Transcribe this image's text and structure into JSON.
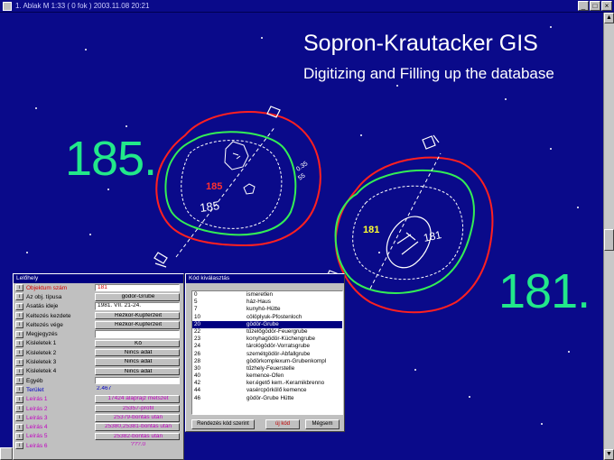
{
  "window": {
    "title": "1. Ablak  M 1:33   ( 0 fok )  2003.11.08 20:21",
    "min": "_",
    "max": "□",
    "close": "×"
  },
  "header": {
    "title": "Sopron-Krautacker GIS",
    "subtitle": "Digitizing and Filling up the database"
  },
  "map": {
    "feature_185": {
      "big_label": "185.",
      "red_label": "185",
      "white_label": "185",
      "dim1": "0.35",
      "dim2": "55"
    },
    "feature_181": {
      "big_label": "181.",
      "yellow_label": "181",
      "white_label": "181"
    }
  },
  "panel": {
    "title": "Lelőhely",
    "info_button": "i",
    "rows": [
      {
        "label": "Objektum szám",
        "value": "181",
        "style": "input",
        "color": "red"
      },
      {
        "label": "Az obj. típusa",
        "value": "gödör-Grube",
        "style": "button"
      },
      {
        "label": "Ásatás ideje",
        "value": "1981. VII. 21-24.",
        "style": "input"
      },
      {
        "label": "Keltezés kezdete",
        "value": "Rézkor-Kupferzeit",
        "style": "button"
      },
      {
        "label": "Keltezés vége",
        "value": "Rézkor-Kupferzeit",
        "style": "button"
      },
      {
        "label": "Megjegyzés",
        "value": "",
        "style": "input"
      },
      {
        "label": "Kisleletek 1",
        "value": "Kő",
        "style": "button"
      },
      {
        "label": "Kisleletek 2",
        "value": "Nincs adat",
        "style": "button"
      },
      {
        "label": "Kisleletek 3",
        "value": "Nincs adat",
        "style": "button"
      },
      {
        "label": "Kisleletek 4",
        "value": "Nincs adat",
        "style": "button"
      },
      {
        "label": "Egyéb",
        "value": "",
        "style": "input"
      },
      {
        "label": "Terület",
        "value": "2.467",
        "style": "plain",
        "color": "blue"
      },
      {
        "label": "Leírás 1",
        "value": "17424 alaprajz metszet",
        "style": "button",
        "color": "mag"
      },
      {
        "label": "Leírás 2",
        "value": "25357-profil",
        "style": "button",
        "color": "mag"
      },
      {
        "label": "Leírás 3",
        "value": "25379-bontás után",
        "style": "button",
        "color": "mag"
      },
      {
        "label": "Leírás 4",
        "value": "25380,25381-bontás után",
        "style": "button",
        "color": "mag"
      },
      {
        "label": "Leírás 5",
        "value": "25382-bontás után",
        "style": "button",
        "color": "mag"
      },
      {
        "label": "Leírás 6",
        "value": "???.0",
        "style": "plain",
        "color": "mag"
      }
    ]
  },
  "dialog": {
    "title": "Kód kiválasztás",
    "codes": [
      {
        "code": "0",
        "desc": "ismeretlen"
      },
      {
        "code": "5",
        "desc": "ház-Haus"
      },
      {
        "code": "7",
        "desc": "kunyhó-Hütte"
      },
      {
        "code": "10",
        "desc": "cölöplyuk-Pfostenloch"
      },
      {
        "code": "20",
        "desc": "gödör-Grube"
      },
      {
        "code": "22",
        "desc": "tűzelőgödör-Feuergrube"
      },
      {
        "code": "23",
        "desc": "konyhagödör-Küchengrube"
      },
      {
        "code": "24",
        "desc": "tárológödör-Vorratsgrube"
      },
      {
        "code": "26",
        "desc": "szemétgödör-Abfallgrube"
      },
      {
        "code": "28",
        "desc": "gödörkomplexum-Grubenkompl"
      },
      {
        "code": "30",
        "desc": "tűzhely-Feuerstelle"
      },
      {
        "code": "40",
        "desc": "kemence-Ofen"
      },
      {
        "code": "42",
        "desc": "ker.égető kem.-Keramikbrenno"
      },
      {
        "code": "44",
        "desc": "vasércpörkölő kemence"
      },
      {
        "code": "46",
        "desc": "gödör-Grube Hütte"
      }
    ],
    "selected_code": "20",
    "buttons": {
      "sort": "Rendezés kód szerint",
      "new": "új kód",
      "cancel": "Mégsem"
    }
  },
  "colors": {
    "background": "#0a0a8a",
    "big_number": "#22e88a",
    "outline_red": "#ff2020",
    "outline_green": "#33ee55",
    "outline_white": "#ffffff"
  }
}
